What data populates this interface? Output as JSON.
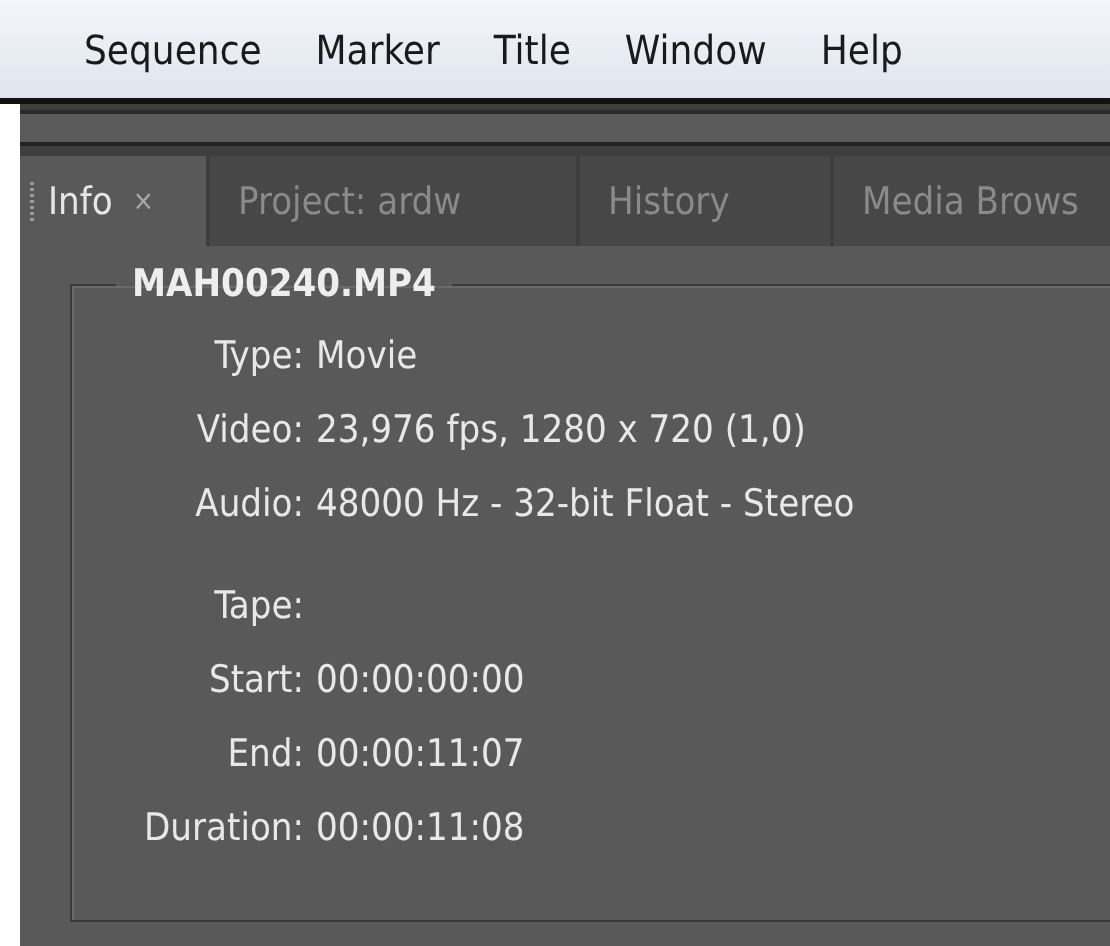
{
  "menu": [
    "Sequence",
    "Marker",
    "Title",
    "Window",
    "Help"
  ],
  "tabs": [
    {
      "label": "Info",
      "selected": true,
      "close": "×"
    },
    {
      "label": "Project: ardw",
      "selected": false
    },
    {
      "label": "History",
      "selected": false
    },
    {
      "label": "Media Brows",
      "selected": false
    }
  ],
  "info": {
    "title": "MAH00240.MP4",
    "groups": [
      [
        {
          "label": "Type:",
          "value": "Movie"
        },
        {
          "label": "Video:",
          "value": "23,976 fps, 1280 x 720 (1,0)"
        },
        {
          "label": "Audio:",
          "value": "48000 Hz - 32-bit Float - Stereo"
        }
      ],
      [
        {
          "label": "Tape:"
        },
        {
          "label": "Start:",
          "value": "00:00:00:00"
        },
        {
          "label": "End:",
          "value": "00:00:11:07"
        },
        {
          "label": "Duration:",
          "value": "00:00:11:08"
        }
      ]
    ]
  }
}
